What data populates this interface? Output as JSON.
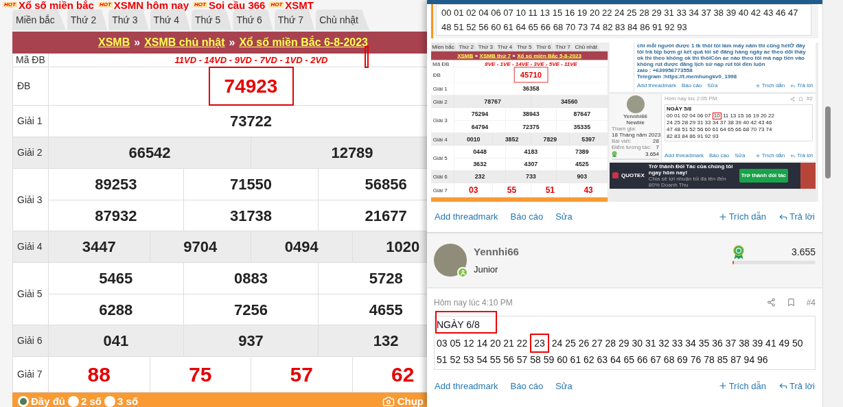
{
  "hot_links": [
    {
      "badge": "HOT",
      "label": "Xổ số miền bắc"
    },
    {
      "badge": "HOT",
      "label": "XSMN hôm nay"
    },
    {
      "badge": "HOT",
      "label": "Soi cầu 366"
    },
    {
      "badge": "HOT",
      "label": "XSMT"
    }
  ],
  "lottery": {
    "tabs": [
      "Miền bắc",
      "Thứ 2",
      "Thứ 3",
      "Thứ 4",
      "Thứ 5",
      "Thứ 6",
      "Thứ 7",
      "Chủ nhật"
    ],
    "breadcrumb": {
      "links": [
        "XSMB",
        "XSMB chủ nhật",
        "Xổ số miền Bắc 6-8-2023"
      ],
      "separator": "»"
    },
    "code_label": "Mã ĐB",
    "code": "11VD - 14VD - 9VD - 7VD - 1VD - 2VD",
    "prizes": [
      {
        "label": "ĐB",
        "kind": "special",
        "highlighted": true,
        "rows": [
          [
            "74923"
          ]
        ]
      },
      {
        "label": "Giải 1",
        "kind": "normal",
        "highlighted": false,
        "rows": [
          [
            "73722"
          ]
        ]
      },
      {
        "label": "Giải 2",
        "kind": "normal",
        "highlighted": false,
        "rows": [
          [
            "66542",
            "12789"
          ]
        ]
      },
      {
        "label": "Giải 3",
        "kind": "normal",
        "highlighted": false,
        "rows": [
          [
            "89253",
            "71550",
            "56856"
          ],
          [
            "87932",
            "31738",
            "21677"
          ]
        ]
      },
      {
        "label": "Giải 4",
        "kind": "normal",
        "highlighted": false,
        "rows": [
          [
            "3447",
            "9704",
            "0494",
            "1020"
          ]
        ]
      },
      {
        "label": "Giải 5",
        "kind": "normal",
        "highlighted": false,
        "rows": [
          [
            "5465",
            "0883",
            "5728"
          ],
          [
            "6288",
            "7256",
            "4655"
          ]
        ]
      },
      {
        "label": "Giải 6",
        "kind": "normal",
        "highlighted": false,
        "rows": [
          [
            "041",
            "937",
            "132"
          ]
        ]
      },
      {
        "label": "Giải 7",
        "kind": "seventh",
        "highlighted": false,
        "rows": [
          [
            "88",
            "75",
            "57",
            "62"
          ]
        ]
      }
    ],
    "footer": {
      "options": [
        {
          "label": "Đầy đủ",
          "selected": true
        },
        {
          "label": "2 số",
          "selected": false
        },
        {
          "label": "3 số",
          "selected": false
        }
      ],
      "capture": "Chụp"
    }
  },
  "thread": {
    "quote": "00 01 02 04 06 07 10 11 13 15 16 19 20 22 24 25 28 29 31 33 34 37 38 39 40 42 43 46 47 48 51 52 56 60 61 64 65 66 68 70 73 74 82 83 84 86 91 92 93",
    "screenshot": {
      "lottery": {
        "tabs": [
          "Miền bắc",
          "Thứ 2",
          "Thứ 3",
          "Thứ 4",
          "Thứ 5",
          "Thứ 6",
          "Thứ 7",
          "Chủ nhật"
        ],
        "breadcrumb": {
          "links": [
            "XSMB",
            "XSMB thứ 7",
            "Xổ số miền Bắc 5-8-2023"
          ],
          "separator": "»"
        },
        "code_label": "Mã ĐB",
        "code": "8VE - 1VE - 14VE - 3VE - 5VE - 11VE",
        "prizes": [
          {
            "label": "ĐB",
            "kind": "special",
            "highlighted": true,
            "rows": [
              [
                "45710"
              ]
            ]
          },
          {
            "label": "Giải 1",
            "kind": "normal",
            "highlighted": false,
            "rows": [
              [
                "36358"
              ]
            ]
          },
          {
            "label": "Giải 2",
            "kind": "normal",
            "highlighted": false,
            "rows": [
              [
                "78767",
                "34560"
              ]
            ]
          },
          {
            "label": "Giải 3",
            "kind": "normal",
            "highlighted": false,
            "rows": [
              [
                "75294",
                "38943",
                "87647"
              ],
              [
                "64794",
                "72375",
                "35335"
              ]
            ]
          },
          {
            "label": "Giải 4",
            "kind": "normal",
            "highlighted": false,
            "rows": [
              [
                "0010",
                "3852",
                "7829",
                "5397"
              ]
            ]
          },
          {
            "label": "Giải 5",
            "kind": "normal",
            "highlighted": false,
            "rows": [
              [
                "0448",
                "4183",
                "7389"
              ],
              [
                "3632",
                "4307",
                "4525"
              ]
            ]
          },
          {
            "label": "Giải 6",
            "kind": "normal",
            "highlighted": false,
            "rows": [
              [
                "232",
                "733",
                "903"
              ]
            ]
          },
          {
            "label": "Giải 7",
            "kind": "seventh",
            "highlighted": false,
            "rows": [
              [
                "03",
                "55",
                "51",
                "43"
              ]
            ]
          }
        ]
      },
      "forum": {
        "intro": {
          "text": "chỉ mỗi người được 1 tk thôi tôi làm mấy năm thì cũng hếtỞ đây tôi trả bịp bợm gì kết quả tôi sẽ đăng hàng ngày ae theo dõi thấy ok thì theo không ok thì thôiCòn ae nào theo tôi mà nạp tiền vào không rút được đăng lịch sử nạp rút tôi đền luôn",
          "lines": [
            "zalo : +639956773558",
            "Telegram :https://t.me/nhungkv0_1998"
          ],
          "actions": {
            "left": [
              "Add threadmark",
              "Báo cáo",
              "Sửa"
            ],
            "quote": "Trích dẫn",
            "reply": "Trả lời"
          }
        },
        "post": {
          "user": "Yennhi66",
          "role": "Newbie",
          "stats": [
            {
              "label": "Tham gia:",
              "value": "18 Tháng năm 2023"
            },
            {
              "label": "Bài viết:",
              "value": "28"
            },
            {
              "label": "Điểm tương tác:",
              "value": "7"
            }
          ],
          "points": "3.654",
          "time": "Hôm nay lúc 2:05 PM",
          "number": "#2",
          "title": "NGÀY 5/8",
          "numbers": [
            {
              "text": "00 01 02 04 06 07",
              "highlighted": false
            },
            {
              "text": "10",
              "highlighted": true
            },
            {
              "text": "11 13 15 16 19 20 22",
              "highlighted": false
            },
            {
              "text": "24 25 28 29 31 33 34",
              "highlighted": false
            },
            {
              "text": "37 38 39 40 42 43 46",
              "highlighted": false
            },
            {
              "text": "47 48 51 52 56 60 61",
              "highlighted": false
            },
            {
              "text": "64 65 66 68 70 73 74",
              "highlighted": false
            },
            {
              "text": "82 83 84 86 91 92 93",
              "highlighted": false
            }
          ],
          "actions": {
            "left": [
              "Add threadmark",
              "Báo cáo",
              "Sửa"
            ],
            "quote": "Trích dẫn",
            "reply": "Trả lời"
          }
        },
        "ad": {
          "brand": "QUOTEX",
          "headline": "Trở thành Đối Tác của chúng tôi ngay hôm nay!",
          "subline": "Chia sẻ lợi nhuận tối đa lên đến 80% Doanh Thu",
          "button": "Trở thành đối tác"
        }
      }
    },
    "actions": {
      "left": [
        "Add threadmark",
        "Báo cáo",
        "Sửa"
      ],
      "quote": "Trích dẫn",
      "reply": "Trả lời"
    },
    "post": {
      "user": "Yennhi66",
      "role": "Junior",
      "points": "3.655",
      "level": 0.02,
      "time": "Hôm nay lúc 4:10 PM",
      "number": "#4",
      "title": "NGÀY 6/8",
      "title_highlighted": true,
      "numbers": [
        {
          "text": "03 05 12 14 20 21 22",
          "highlighted": false
        },
        {
          "text": "23",
          "highlighted": true
        },
        {
          "text": "24 25 26 27 28 29 30 31 32 33 34 35 36 37 38 39 41 49 50",
          "highlighted": false
        },
        {
          "text": "51 52 53 54 55 56 57 58 59 60 61 62 63 64 65 66 67 68 69 76 78 85 87 94 96",
          "highlighted": false
        }
      ],
      "actions": {
        "left": [
          "Add threadmark",
          "Báo cáo",
          "Sửa"
        ],
        "quote": "Trích dẫn",
        "reply": "Trả lời"
      }
    }
  }
}
